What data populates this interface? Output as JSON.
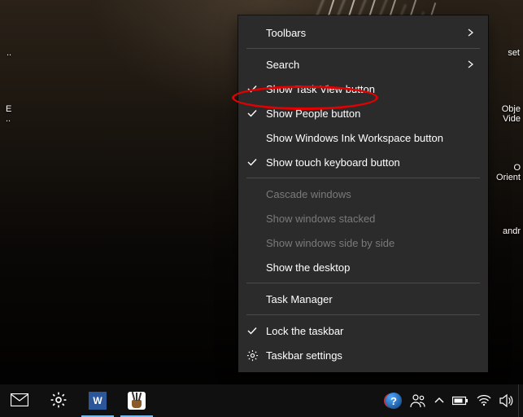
{
  "desktop": {
    "label_top_right": "set",
    "label_mid_left": "E\n..",
    "label_dots": "..",
    "label_obj_video": "Obje\nVide",
    "label_o_orient": "O\nOrient",
    "label_andr": "andr"
  },
  "context_menu": {
    "toolbars": "Toolbars",
    "search": "Search",
    "show_task_view": "Show Task View button",
    "show_people": "Show People button",
    "show_ink": "Show Windows Ink Workspace button",
    "show_touch_kb": "Show touch keyboard button",
    "cascade": "Cascade windows",
    "stacked": "Show windows stacked",
    "side_by_side": "Show windows side by side",
    "show_desktop": "Show the desktop",
    "task_manager": "Task Manager",
    "lock_taskbar": "Lock the taskbar",
    "taskbar_settings": "Taskbar settings"
  },
  "highlight": {
    "target": "show_task_view"
  },
  "taskbar": {
    "apps": {
      "mail": "Mail",
      "settings": "Settings",
      "word": "W",
      "paint": "Paint"
    },
    "tray": {
      "help": "?",
      "people": "People",
      "chevron": "Show hidden icons",
      "battery": "Battery",
      "wifi": "Network",
      "volume": "Volume"
    }
  }
}
